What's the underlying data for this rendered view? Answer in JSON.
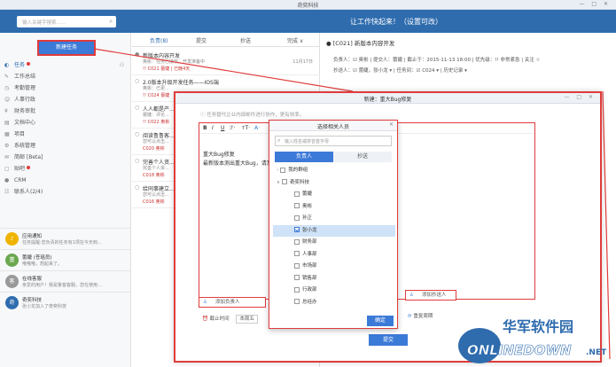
{
  "window": {
    "title": "奇奕科技",
    "controls": "— □ ✕"
  },
  "banner": {
    "message": "让工作快起来！（设置可改）",
    "search_placeholder": "输入关键字搜索......"
  },
  "sidebar": {
    "new_task": "新建任务",
    "items": [
      {
        "label": "任务",
        "icon": "task-icon",
        "badge": true,
        "active": true
      },
      {
        "label": "工作总结",
        "icon": "pencil-icon"
      },
      {
        "label": "考勤管理",
        "icon": "clock-icon"
      },
      {
        "label": "人事行政",
        "icon": "person-icon"
      },
      {
        "label": "财务审批",
        "icon": "yen-icon"
      },
      {
        "label": "文档中心",
        "icon": "doc-icon"
      },
      {
        "label": "项目",
        "icon": "grid-icon"
      },
      {
        "label": "系统管理",
        "icon": "gear-icon"
      },
      {
        "label": "简邮 [Beta]",
        "icon": "mail-icon"
      },
      {
        "label": "贴吧",
        "icon": "chat-icon",
        "badge": true
      },
      {
        "label": "CRM",
        "icon": "crm-icon"
      },
      {
        "label": "联系人(2/4)",
        "icon": "contacts-icon"
      }
    ],
    "notifications": [
      {
        "title": "应用通知",
        "sub": "任务提醒:您负责的任务有1项在今天到...",
        "color": "#f0b400",
        "avatar": "♪"
      },
      {
        "title": "蕾婕 (苍瑶员)",
        "sub": "哦哦哦，想起来了。",
        "color": "#6aa84f",
        "avatar": "蕾"
      },
      {
        "title": "在线客服",
        "sub": "亲爱的用户！我是鲁客客服，您在使用...",
        "color": "#999999",
        "avatar": "客"
      },
      {
        "title": "奇奕科技",
        "sub": "张小龙加入了奇奕科技",
        "color": "#2f6cae",
        "avatar": "奇"
      }
    ]
  },
  "list": {
    "tabs": [
      "负责(8)",
      "提交",
      "抄送",
      "完成 ∨"
    ],
    "tasks": [
      {
        "title": "新版本内容开发",
        "sub1": "奥彬：任务已接收，开发准备中",
        "sub2": "!! C021 蕾婕 | 已晚4天",
        "date": "11月17日"
      },
      {
        "title": "2.0版本升级开发任务——IOS端",
        "sub1": "奥彬：已更...",
        "sub2": "!! C024 蕾婕"
      },
      {
        "title": "人人都是产...",
        "sub1": "蕾婕：评论...",
        "sub2": "!! C022 奥彬"
      },
      {
        "title": "阅读鲁鲁客...",
        "sub1": "您可以点击...",
        "sub2": "C020 奥彬"
      },
      {
        "title": "完善个人资...",
        "sub1": "完善个人资...",
        "sub2": "C018 奥彬"
      },
      {
        "title": "给同事建立...",
        "sub1": "您可以点击...",
        "sub2": "C016 奥彬"
      }
    ]
  },
  "detail": {
    "title": "[C021] 新版本内容开发",
    "meta1": "负责人：☑ 奥彬  |  提交人：蕾婕  |  截止于：2015-11-13 18:00  |  优先级：!! 非常紧急  |  关注 ☆",
    "meta2": "抄送人：☑ 蕾婕，张小龙 ▾  |  任务间：☑ C024 ▾  |  历史记录 ▾"
  },
  "dialog": {
    "title": "新建：重大Bug修复",
    "hint": "任务替代企业内部邮件进行协作，更有效率。",
    "toolbar": [
      "B",
      "I",
      "U",
      "ℱ·",
      "ᴛT·",
      "A·"
    ],
    "body_line1": "重大Bug修复",
    "body_line2": "最新版本测出重大Bug，请及时...",
    "add_owner": "添加负责人",
    "add_cc": "添加抄送人",
    "deadline_label": "截止时间",
    "deadline_value": "本周五",
    "repeat": "重复周期",
    "submit": "提交"
  },
  "picker": {
    "title": "选择相关人员",
    "search_placeholder": "输入姓名或拼音首字母",
    "tab_owner": "负责人",
    "tab_cc": "抄送",
    "rows": [
      {
        "label": "我的群组",
        "level": 1,
        "arrow": "›",
        "checked": false
      },
      {
        "label": "奇奕科技",
        "level": 1,
        "arrow": "∨",
        "checked": false
      },
      {
        "label": "蕾婕",
        "level": 2,
        "checked": false
      },
      {
        "label": "奥彬",
        "level": 2,
        "checked": false
      },
      {
        "label": "孙正",
        "level": 2,
        "checked": false
      },
      {
        "label": "张小龙",
        "level": 2,
        "checked": true,
        "selected": true
      },
      {
        "label": "财务部",
        "level": 2,
        "arrow": "›",
        "checked": false
      },
      {
        "label": "人事部",
        "level": 2,
        "arrow": "›",
        "checked": false
      },
      {
        "label": "市场部",
        "level": 2,
        "arrow": "›",
        "checked": false
      },
      {
        "label": "销售部",
        "level": 2,
        "arrow": "›",
        "checked": false
      },
      {
        "label": "行政部",
        "level": 2,
        "arrow": "›",
        "checked": false
      },
      {
        "label": "总经办",
        "level": 2,
        "arrow": "›",
        "checked": false
      }
    ],
    "ok": "确定"
  },
  "watermark": {
    "cn": "华军软件园",
    "en": "ONLINEDOWN",
    "suffix": ".NET"
  }
}
